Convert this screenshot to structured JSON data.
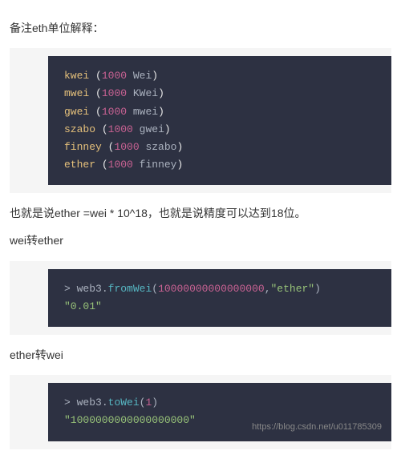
{
  "para1": "备注eth单位解释：",
  "units": {
    "l0": {
      "name": "kwei",
      "open": "(",
      "num": "1000",
      "inner": " Wei",
      "close": ")"
    },
    "l1": {
      "name": "mwei",
      "open": "(",
      "num": "1000",
      "inner": " KWei",
      "close": ")"
    },
    "l2": {
      "name": "gwei",
      "open": "(",
      "num": "1000",
      "inner": " mwei",
      "close": ")"
    },
    "l3": {
      "name": "szabo",
      "open": "(",
      "num": "1000",
      "inner": " gwei",
      "close": ")"
    },
    "l4": {
      "name": "finney",
      "open": "(",
      "num": "1000",
      "inner": " szabo",
      "close": ")"
    },
    "l5": {
      "name": "ether",
      "open": "(",
      "num": "1000",
      "inner": " finney",
      "close": ")"
    }
  },
  "para2": "也就是说ether =wei * 10^18，也就是说精度可以达到18位。",
  "para3": "wei转ether",
  "code2": {
    "prompt": "> ",
    "obj": "web3",
    "dot": ".",
    "method": "fromWei",
    "open": "(",
    "arg1": "10000000000000000",
    "comma": ",",
    "arg2": "\"ether\"",
    "close": ")",
    "result": "\"0.01\""
  },
  "para4": "ether转wei",
  "code3": {
    "prompt": "> ",
    "obj": "web3",
    "dot": ".",
    "method": "toWei",
    "open": "(",
    "arg1": "1",
    "close": ")",
    "result": "\"1000000000000000000\""
  },
  "watermark": "https://blog.csdn.net/u011785309"
}
